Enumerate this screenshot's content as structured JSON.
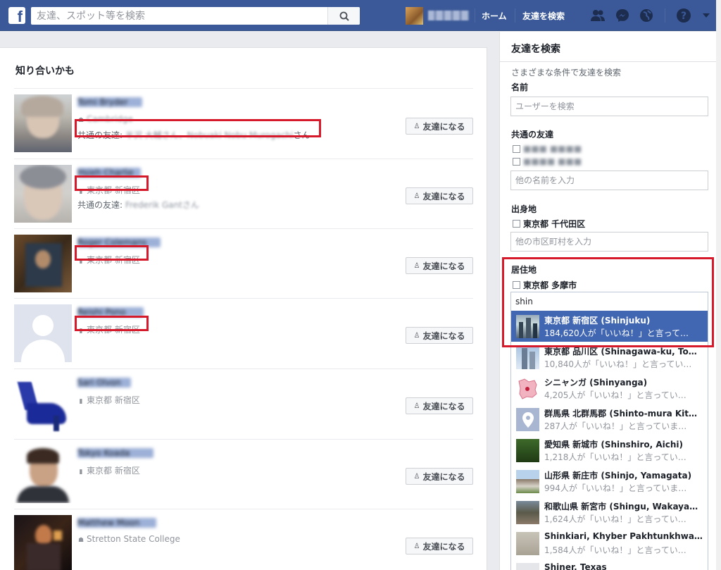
{
  "topbar": {
    "logo": "f",
    "search_placeholder": "友達、スポット等を検索",
    "home_label": "ホーム",
    "find_friends_label": "友達を検索",
    "user_name": "■■■ ■■"
  },
  "main": {
    "title": "知り合いかも",
    "add_friend_label": "友達になる",
    "people": [
      {
        "name": "Tomi Bryder",
        "line1": "Cambridge",
        "line1_icon": "☗",
        "mutual_prefix": "共通の友達: ",
        "mutual_names": "半沢 大輔さん、Nobuaki Nobu Murogachi",
        "mutual_suffix": "さん"
      },
      {
        "name": "Hsieh Charlie",
        "line1": "東京都 新宿区",
        "line1_icon": "▮",
        "mutual_prefix": "共通の友達: ",
        "mutual_names": "Frederik Gantさん",
        "mutual_suffix": ""
      },
      {
        "name": "Roger Colemans",
        "line1": "東京都 新宿区",
        "line1_icon": "▮"
      },
      {
        "name": "Reishi Pono",
        "line1": "東京都 新宿区",
        "line1_icon": "▮"
      },
      {
        "name": "Sari Olvon",
        "line1": "東京都 新宿区",
        "line1_icon": "▮"
      },
      {
        "name": "Tokyo Koada",
        "line1": "東京都 新宿区",
        "line1_icon": "▮"
      },
      {
        "name": "Matthew Moon",
        "line1": "Stretton State College",
        "line1_icon": "☗"
      }
    ]
  },
  "panel": {
    "title": "友達を検索",
    "subtitle": "さまざまな条件で友達を検索",
    "name_label": "名前",
    "name_placeholder": "ユーザーを検索",
    "mutual_label": "共通の友達",
    "mutual_options": [
      "■■■ ■■■■",
      "■■■■ ■■■"
    ],
    "mutual_placeholder": "他の名前を入力",
    "hometown_label": "出身地",
    "hometown_option": "東京都 千代田区",
    "hometown_placeholder": "他の市区町村を入力",
    "residence_label": "居住地",
    "residence_option": "東京都 多摩市",
    "residence_value": "shin",
    "suggestions": [
      {
        "title": "東京都 新宿区 (Shinjuku)",
        "sub": "184,620人が「いいね！」と言って…",
        "thumb": "city"
      },
      {
        "title": "東京都 品川区 (Shinagawa-ku, To…",
        "sub": "10,840人が「いいね！」と言ってい…",
        "thumb": "tower"
      },
      {
        "title": "シニャンガ (Shinyanga)",
        "sub": "4,205人が「いいね！」と言ってい…",
        "thumb": "map"
      },
      {
        "title": "群馬県 北群馬郡 (Shinto-mura Kit…",
        "sub": "287人が「いいね！」と言っていま…",
        "thumb": "pin"
      },
      {
        "title": "愛知県 新城市 (Shinshiro, Aichi)",
        "sub": "1,218人が「いいね！」と言ってい…",
        "thumb": "trees"
      },
      {
        "title": "山形県 新庄市 (Shinjo, Yamagata)",
        "sub": "994人が「いいね！」と言っていま…",
        "thumb": "building"
      },
      {
        "title": "和歌山県 新宮市 (Shingu, Wakaya…",
        "sub": "1,624人が「いいね！」と言ってい…",
        "thumb": "town"
      },
      {
        "title": "Shinkiari, Khyber Pakhtunkhwa…",
        "sub": "1,584人が「いいね！」と言ってい…",
        "thumb": "stone"
      },
      {
        "title": "Shiner, Texas",
        "sub": "",
        "thumb": "plain"
      }
    ]
  },
  "colors": {
    "brand": "#3b5998",
    "highlight": "#d6192b",
    "selected": "#4267b2"
  }
}
